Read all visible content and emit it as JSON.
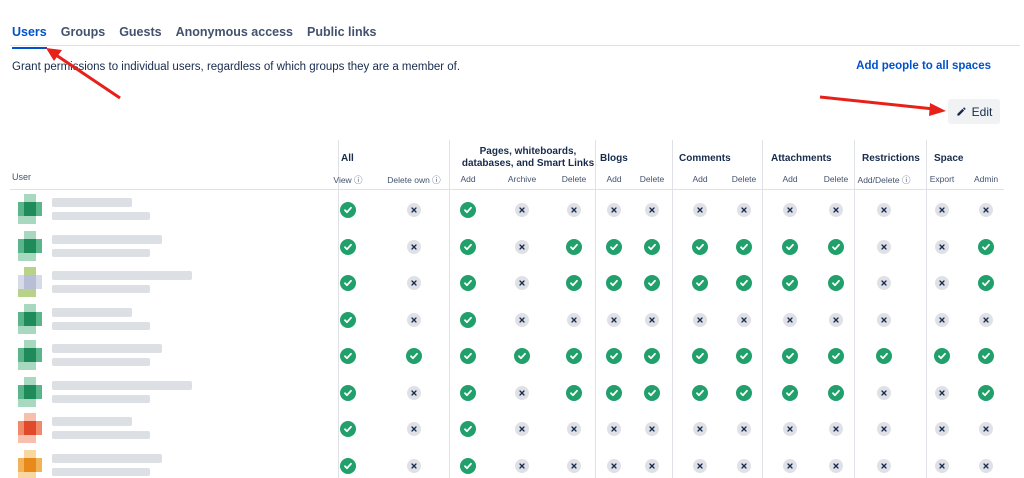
{
  "tabs": [
    {
      "label": "Users",
      "active": true
    },
    {
      "label": "Groups",
      "active": false
    },
    {
      "label": "Guests",
      "active": false
    },
    {
      "label": "Anonymous access",
      "active": false
    },
    {
      "label": "Public links",
      "active": false
    }
  ],
  "description": "Grant permissions to individual users, regardless of which groups they are a member of.",
  "add_people_label": "Add people to all spaces",
  "edit_label": "Edit",
  "table": {
    "user_header": "User",
    "groups": [
      {
        "label": "All",
        "subs": [
          "View ⓘ",
          "Delete own ⓘ"
        ]
      },
      {
        "label": "Pages, whiteboards, databases, and Smart Links",
        "subs": [
          "Add",
          "Archive",
          "Delete"
        ]
      },
      {
        "label": "Blogs",
        "subs": [
          "Add",
          "Delete"
        ]
      },
      {
        "label": "Comments",
        "subs": [
          "Add",
          "Delete"
        ]
      },
      {
        "label": "Attachments",
        "subs": [
          "Add",
          "Delete"
        ]
      },
      {
        "label": "Restrictions",
        "subs": [
          "Add/Delete ⓘ"
        ]
      },
      {
        "label": "Space",
        "subs": [
          "Export",
          "Admin"
        ]
      }
    ],
    "rows": [
      {
        "avatar_colors": [
          "#1f8a5a",
          "#5ab58a",
          "#a8d8bf"
        ],
        "perms": [
          1,
          0,
          1,
          0,
          0,
          0,
          0,
          0,
          0,
          0,
          0,
          0,
          0,
          0
        ]
      },
      {
        "avatar_colors": [
          "#1f8a5a",
          "#5ab58a",
          "#a8d8bf"
        ],
        "perms": [
          1,
          0,
          1,
          0,
          1,
          1,
          1,
          1,
          1,
          1,
          1,
          0,
          0,
          1
        ]
      },
      {
        "avatar_colors": [
          "#b7bed6",
          "#d7dbe8",
          "#b8d28a"
        ],
        "perms": [
          1,
          0,
          1,
          0,
          1,
          1,
          1,
          1,
          1,
          1,
          1,
          0,
          0,
          1
        ]
      },
      {
        "avatar_colors": [
          "#1f8a5a",
          "#5ab58a",
          "#a8d8bf"
        ],
        "perms": [
          1,
          0,
          1,
          0,
          0,
          0,
          0,
          0,
          0,
          0,
          0,
          0,
          0,
          0
        ]
      },
      {
        "avatar_colors": [
          "#1f8a5a",
          "#5ab58a",
          "#a8d8bf"
        ],
        "perms": [
          1,
          1,
          1,
          1,
          1,
          1,
          1,
          1,
          1,
          1,
          1,
          1,
          1,
          1
        ]
      },
      {
        "avatar_colors": [
          "#1f8a5a",
          "#5ab58a",
          "#a8d8bf"
        ],
        "perms": [
          1,
          0,
          1,
          0,
          1,
          1,
          1,
          1,
          1,
          1,
          1,
          0,
          0,
          1
        ]
      },
      {
        "avatar_colors": [
          "#e04a2a",
          "#f08a6a",
          "#f6c0ac"
        ],
        "perms": [
          1,
          0,
          1,
          0,
          0,
          0,
          0,
          0,
          0,
          0,
          0,
          0,
          0,
          0
        ]
      },
      {
        "avatar_colors": [
          "#e88a1a",
          "#f2b25a",
          "#f8d8a0"
        ],
        "perms": [
          1,
          0,
          1,
          0,
          0,
          0,
          0,
          0,
          0,
          0,
          0,
          0,
          0,
          0
        ]
      }
    ]
  },
  "colors": {
    "accent": "#0052cc",
    "granted": "#22a06b",
    "denied": "#dfe1e6",
    "annotation": "#e8201a"
  }
}
